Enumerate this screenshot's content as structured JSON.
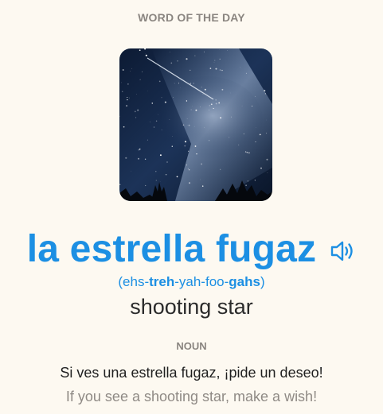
{
  "header": {
    "title": "WORD OF THE DAY"
  },
  "card": {
    "image_alt": "night sky with milky way and shooting star",
    "word": "la estrella fugaz",
    "speaker_icon": "speaker-icon",
    "pronunciation": {
      "open": "(",
      "parts": [
        "ehs-",
        "treh",
        "-yah-foo-",
        "gahs"
      ],
      "close": ")"
    },
    "translation": "shooting star",
    "part_of_speech": "NOUN",
    "example": "Si ves una estrella fugaz, ¡pide un deseo!",
    "example_translation": "If you see a shooting star, make a wish!"
  },
  "colors": {
    "accent": "#1c8fe3",
    "background": "#fdf9f1",
    "muted": "#8a8580"
  }
}
